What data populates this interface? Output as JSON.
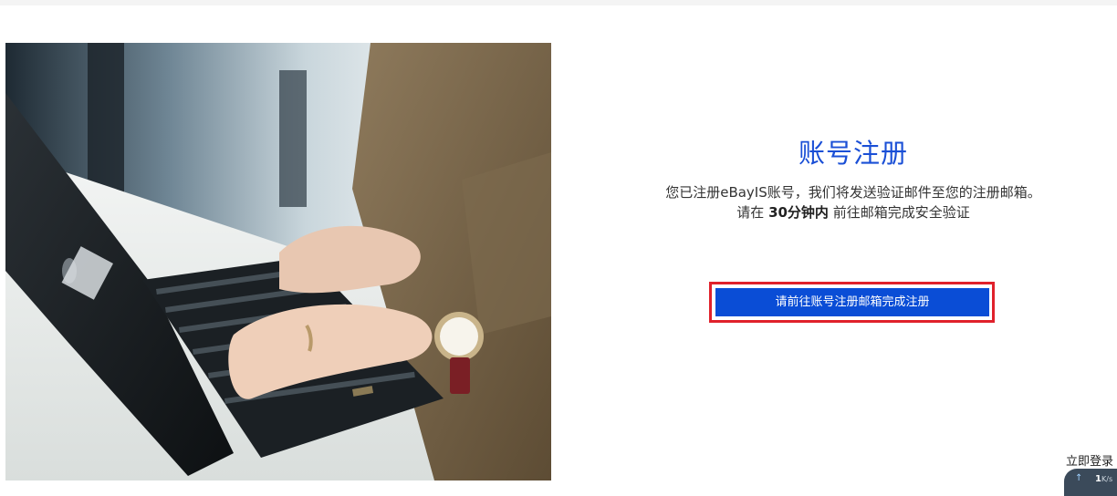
{
  "register": {
    "title": "账号注册",
    "line1": "您已注册eBayIS账号，我们将发送验证邮件至您的注册邮箱。",
    "line2_prefix": "请在 ",
    "line2_strong": "30分钟内",
    "line2_suffix": " 前往邮箱完成安全验证",
    "cta_label": "请前往账号注册邮箱完成注册"
  },
  "footer": {
    "login_label": "立即登录"
  },
  "speed_widget": {
    "value": "1",
    "unit": "K/s"
  },
  "colors": {
    "accent": "#1a4fd6",
    "button": "#0a4dd6",
    "highlight_border": "#e0212b"
  },
  "icons": {
    "hero": "laptop-typing-photo",
    "upload": "up-arrow-icon"
  }
}
